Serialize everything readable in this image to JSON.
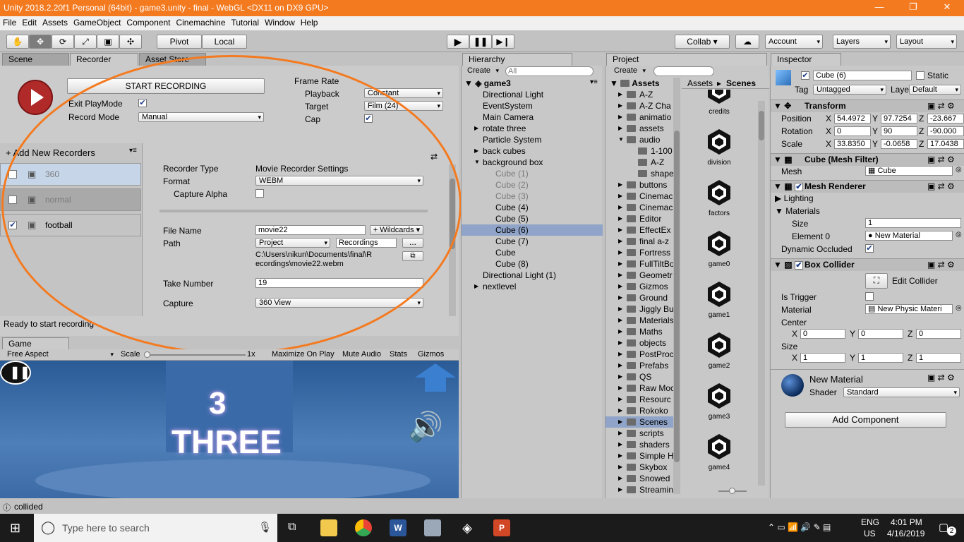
{
  "title": "Unity 2018.2.20f1 Personal (64bit) - game3.unity - final - WebGL <DX11 on DX9 GPU>",
  "menu": [
    "File",
    "Edit",
    "Assets",
    "GameObject",
    "Component",
    "Cinemachine",
    "Tutorial",
    "Window",
    "Help"
  ],
  "toolbar": {
    "pivot": "Pivot",
    "local": "Local",
    "collab": "Collab ▾",
    "account": "Account",
    "layers": "Layers",
    "layout": "Layout"
  },
  "tabs": {
    "scene": "Scene",
    "recorder": "Recorder",
    "asset_store": "Asset Store",
    "hierarchy": "Hierarchy",
    "project": "Project",
    "inspector": "Inspector",
    "game": "Game"
  },
  "recorder": {
    "start": "START RECORDING",
    "exit_playmode": "Exit PlayMode",
    "record_mode": "Record Mode",
    "record_mode_value": "Manual",
    "frame_rate": "Frame Rate",
    "playback": "Playback",
    "playback_value": "Constant",
    "target": "Target",
    "target_value": "Film (24)",
    "cap": "Cap",
    "add_new": "+ Add New Recorders",
    "recorders": [
      {
        "name": "360",
        "checked": false
      },
      {
        "name": "normal",
        "checked": false
      },
      {
        "name": "football",
        "checked": true
      }
    ],
    "recorder_type": "Recorder Type",
    "recorder_type_value": "Movie Recorder Settings",
    "format": "Format",
    "format_value": "WEBM",
    "capture_alpha": "Capture Alpha",
    "file_name": "File Name",
    "file_name_value": "movie22",
    "wildcards": "+ Wildcards ▾",
    "path": "Path",
    "path_value": "Project",
    "path_folder": "Recordings",
    "browse": "...",
    "full_path_1": "C:\\Users\\nikun\\Documents\\final\\R",
    "full_path_2": "ecordings\\movie22.webm",
    "take_number": "Take Number",
    "take_number_value": "19",
    "capture": "Capture",
    "capture_value": "360 View",
    "status": "Ready to start recording"
  },
  "game": {
    "aspect": "Free Aspect",
    "scale": "Scale",
    "scale_value": "1x",
    "maximize": "Maximize On Play",
    "mute": "Mute Audio",
    "stats": "Stats",
    "gizmos": "Gizmos",
    "number": "3",
    "word": "THREE"
  },
  "hierarchy": {
    "create": "Create",
    "search_placeholder": "All",
    "scene": "game3",
    "items": [
      {
        "label": "Directional Light",
        "indent": 1,
        "arrow": "",
        "gray": false
      },
      {
        "label": "EventSystem",
        "indent": 1,
        "arrow": "",
        "gray": false
      },
      {
        "label": "Main Camera",
        "indent": 1,
        "arrow": "",
        "gray": false
      },
      {
        "label": "rotate three",
        "indent": 1,
        "arrow": "▶",
        "gray": false
      },
      {
        "label": "Particle System",
        "indent": 1,
        "arrow": "",
        "gray": false
      },
      {
        "label": "back cubes",
        "indent": 1,
        "arrow": "▶",
        "gray": false
      },
      {
        "label": "background box",
        "indent": 1,
        "arrow": "▼",
        "gray": false
      },
      {
        "label": "Cube (1)",
        "indent": 2,
        "arrow": "",
        "gray": true
      },
      {
        "label": "Cube (2)",
        "indent": 2,
        "arrow": "",
        "gray": true
      },
      {
        "label": "Cube (3)",
        "indent": 2,
        "arrow": "",
        "gray": true
      },
      {
        "label": "Cube (4)",
        "indent": 2,
        "arrow": "",
        "gray": false
      },
      {
        "label": "Cube (5)",
        "indent": 2,
        "arrow": "",
        "gray": false
      },
      {
        "label": "Cube (6)",
        "indent": 2,
        "arrow": "",
        "gray": false,
        "selected": true
      },
      {
        "label": "Cube (7)",
        "indent": 2,
        "arrow": "",
        "gray": false
      },
      {
        "label": "Cube",
        "indent": 2,
        "arrow": "",
        "gray": false
      },
      {
        "label": "Cube (8)",
        "indent": 2,
        "arrow": "",
        "gray": false
      },
      {
        "label": "Directional Light (1)",
        "indent": 1,
        "arrow": "",
        "gray": false
      },
      {
        "label": "nextlevel",
        "indent": 1,
        "arrow": "▶",
        "gray": false
      }
    ]
  },
  "project": {
    "create": "Create",
    "root": "Assets",
    "crumb_assets": "Assets",
    "crumb_scenes": "Scenes",
    "folders": [
      {
        "label": "A-Z",
        "indent": 1
      },
      {
        "label": "A-Z Cha",
        "indent": 1
      },
      {
        "label": "animatio",
        "indent": 1
      },
      {
        "label": "assets",
        "indent": 1
      },
      {
        "label": "audio",
        "indent": 1,
        "open": true
      },
      {
        "label": "1-100",
        "indent": 2
      },
      {
        "label": "A-Z",
        "indent": 2
      },
      {
        "label": "shape",
        "indent": 2
      },
      {
        "label": "buttons",
        "indent": 1
      },
      {
        "label": "Cinemac",
        "indent": 1
      },
      {
        "label": "Cinemac",
        "indent": 1
      },
      {
        "label": "Editor",
        "indent": 1
      },
      {
        "label": "EffectEx",
        "indent": 1
      },
      {
        "label": "final a-z",
        "indent": 1
      },
      {
        "label": "Fortress",
        "indent": 1
      },
      {
        "label": "FullTiltBo",
        "indent": 1
      },
      {
        "label": "Geometr",
        "indent": 1
      },
      {
        "label": "Gizmos",
        "indent": 1
      },
      {
        "label": "Ground",
        "indent": 1
      },
      {
        "label": "Jiggly Bu",
        "indent": 1
      },
      {
        "label": "Materials",
        "indent": 1
      },
      {
        "label": "Maths",
        "indent": 1
      },
      {
        "label": "objects",
        "indent": 1
      },
      {
        "label": "PostProc",
        "indent": 1
      },
      {
        "label": "Prefabs",
        "indent": 1
      },
      {
        "label": "QS",
        "indent": 1
      },
      {
        "label": "Raw Moc",
        "indent": 1
      },
      {
        "label": "Resourc",
        "indent": 1
      },
      {
        "label": "Rokoko",
        "indent": 1
      },
      {
        "label": "Scenes",
        "indent": 1,
        "selected": true
      },
      {
        "label": "scripts",
        "indent": 1
      },
      {
        "label": "shaders",
        "indent": 1
      },
      {
        "label": "Simple H",
        "indent": 1
      },
      {
        "label": "Skybox",
        "indent": 1
      },
      {
        "label": "Snowed",
        "indent": 1
      },
      {
        "label": "Streamin",
        "indent": 1
      }
    ],
    "scenes": [
      "credits",
      "division",
      "factors",
      "game0",
      "game1",
      "game2",
      "game3",
      "game4"
    ]
  },
  "inspector": {
    "object_name": "Cube (6)",
    "static": "Static",
    "tag": "Tag",
    "tag_value": "Untagged",
    "layer": "Layer",
    "layer_value": "Default",
    "transform": "Transform",
    "position": "Position",
    "rotation": "Rotation",
    "scale": "Scale",
    "pos": [
      "54.4972",
      "97.7254",
      "-23.667"
    ],
    "rot": [
      "0",
      "90",
      "-90.000"
    ],
    "scl": [
      "33.8350",
      "-0.0658",
      "17.0438"
    ],
    "mesh_filter": "Cube (Mesh Filter)",
    "mesh": "Mesh",
    "mesh_value": "Cube",
    "mesh_renderer": "Mesh Renderer",
    "lighting": "Lighting",
    "materials": "Materials",
    "size": "Size",
    "size_value": "1",
    "element0": "Element 0",
    "element0_value": "New Material",
    "dynamic_occluded": "Dynamic Occluded",
    "box_collider": "Box Collider",
    "edit_collider": "Edit Collider",
    "is_trigger": "Is Trigger",
    "material": "Material",
    "material_value": "New Physic Materi",
    "center": "Center",
    "center_vals": [
      "0",
      "0",
      "0"
    ],
    "size_label": "Size",
    "size_vals": [
      "1",
      "1",
      "1"
    ],
    "new_material": "New Material",
    "shader": "Shader",
    "shader_value": "Standard",
    "add_component": "Add Component"
  },
  "statusbar": "collided",
  "taskbar": {
    "search": "Type here to search",
    "lang1": "ENG",
    "lang2": "US",
    "time": "4:01 PM",
    "date": "4/16/2019",
    "notif": "2"
  },
  "colors": {
    "title": "#f47a20",
    "annotation": "#f47a20",
    "game_bg": "#2e5f9a"
  }
}
